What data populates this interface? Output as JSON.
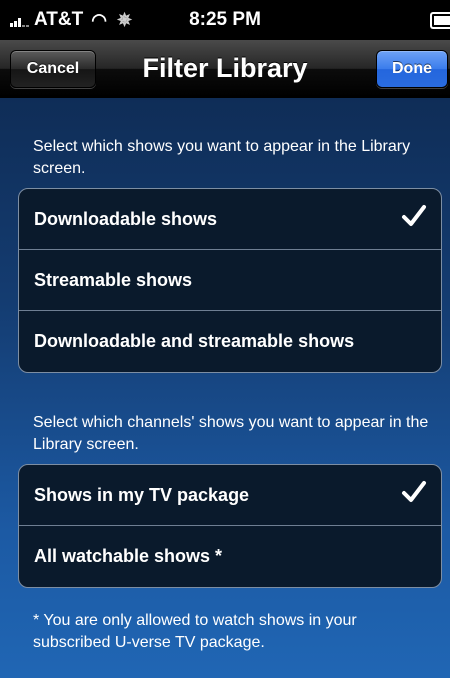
{
  "status_bar": {
    "carrier": "AT&T",
    "time": "8:25 PM"
  },
  "nav": {
    "title": "Filter Library",
    "cancel_label": "Cancel",
    "done_label": "Done"
  },
  "shows_section": {
    "description": "Select which shows you want to appear in the Library screen.",
    "options": [
      {
        "label": "Downloadable shows",
        "checked": true
      },
      {
        "label": "Streamable shows",
        "checked": false
      },
      {
        "label": "Downloadable and streamable shows",
        "checked": false
      }
    ]
  },
  "channels_section": {
    "description": "Select which channels' shows you want to appear in the Library screen.",
    "options": [
      {
        "label": "Shows in my TV package",
        "checked": true
      },
      {
        "label": "All watchable shows *",
        "checked": false
      }
    ]
  },
  "footnote": "* You are only allowed to watch shows in your subscribed U-verse TV package.",
  "colors": {
    "done_button": "#3a7cec",
    "background_blue": "#1c5aa4"
  }
}
